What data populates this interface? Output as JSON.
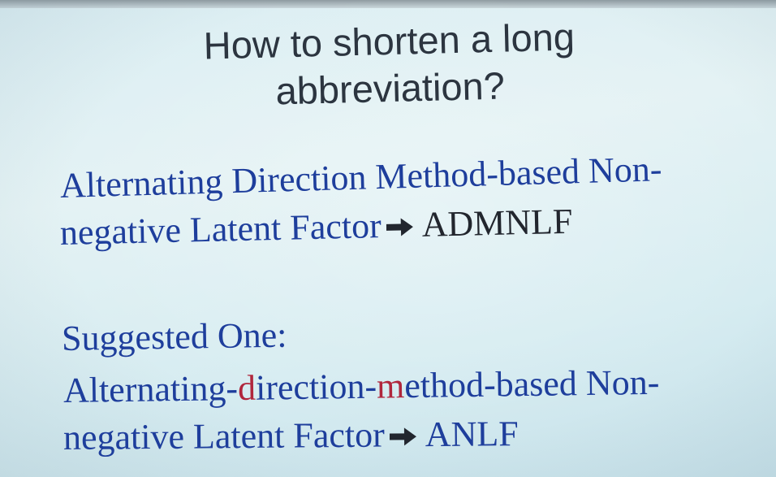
{
  "title": {
    "line1": "How to shorten a long",
    "line2": "abbreviation?"
  },
  "original": {
    "line1": "Alternating Direction Method-based Non-",
    "line2_text": "negative Latent Factor",
    "arrow_icon": "right-arrow-icon",
    "abbreviation": "ADMNLF"
  },
  "suggested": {
    "heading": "Suggested One:",
    "line1_part1": "Alternating-",
    "line1_d": "d",
    "line1_part2": "irection-",
    "line1_m": "m",
    "line1_part3": "ethod-based Non-",
    "line2_text": "negative Latent Factor",
    "arrow_icon": "right-arrow-icon",
    "abbreviation": "ANLF"
  },
  "colors": {
    "background": "#dbeef3",
    "title": "#2c3540",
    "body_blue": "#1e3e9c",
    "abbreviation_dark": "#22262e",
    "highlight_red": "#b0263c"
  }
}
